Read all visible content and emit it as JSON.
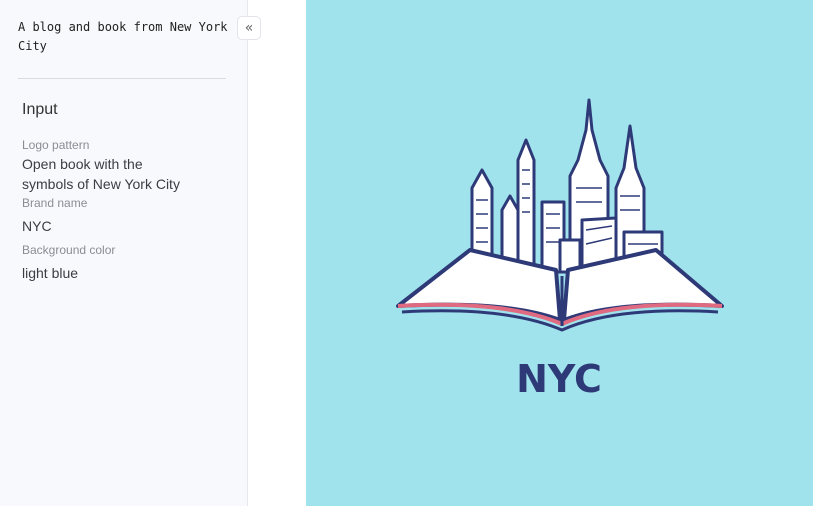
{
  "sidebar": {
    "tagline": "A blog and book from New York City",
    "collapse_icon": "double-chevron-left-icon",
    "section_title": "Input",
    "fields": [
      {
        "label": "Logo pattern",
        "value": "Open book with the symbols of New York City"
      },
      {
        "label": "Brand name",
        "value": "NYC"
      },
      {
        "label": "Background color",
        "value": "light blue"
      }
    ]
  },
  "image": {
    "brand_text": "NYC",
    "background_color": "#a0e3ec",
    "ink_color": "#2e3a78",
    "accent_color": "#e06a80"
  }
}
